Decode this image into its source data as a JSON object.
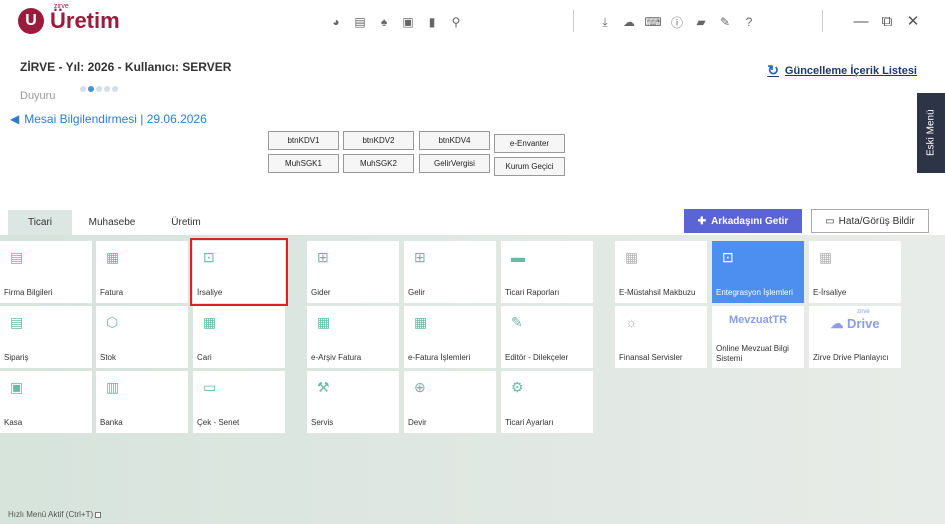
{
  "logo": {
    "mark": "U",
    "small": "zirve",
    "name": "Üretim"
  },
  "header": {
    "title": "ZİRVE - Yıl: 2026 - Kullanıcı: SERVER",
    "update_link": "Güncelleme İçerik Listesi",
    "duyuru_label": "Duyuru",
    "announcement": "Mesai Bilgilendirmesi | 29.06.2026"
  },
  "quick_buttons": [
    "btnKDV1",
    "btnKDV2",
    "btnKDV4",
    "e-Envanter",
    "MuhSGK1",
    "MuhSGK2",
    "GelirVergisi",
    "Kurum Geçici"
  ],
  "eski_menu": "Eski Menü",
  "tabs": [
    "Ticari",
    "Muhasebe",
    "Üretim"
  ],
  "actions": {
    "invite": "Arkadaşını Getir",
    "report": "Hata/Görüş Bildir"
  },
  "tiles": [
    "Firma Bilgileri",
    "Fatura",
    "İrsaliye",
    "Gider",
    "Gelir",
    "Ticari Raporları",
    "E-Müstahsil Makbuzu",
    "Entegrasyon İşlemleri",
    "E-İrsaliye",
    "Sipariş",
    "Stok",
    "Cari",
    "e-Arşiv Fatura",
    "e-Fatura İşlemleri",
    "Editör - Dilekçeler",
    "Finansal Servisler",
    "Online Mevzuat Bilgi Sistemi",
    "Zirve Drive Planlayıcı",
    "Kasa",
    "Banka",
    "Çek - Senet",
    "Servis",
    "Devir",
    "Ticari Ayarları"
  ],
  "brands": {
    "mevzuat": "MevzuatTR",
    "drive_small": "zirve",
    "drive": "Drive"
  },
  "footer": {
    "quick_menu": "Hızlı Menü Aktif (Ctrl+T)"
  },
  "colors": {
    "brand": "#9b1b3c",
    "accent_blue": "#4d8ff0",
    "invite_button": "#5b64d4",
    "selected_outline": "#e31e24",
    "tile_icon": "#69b9a7"
  }
}
